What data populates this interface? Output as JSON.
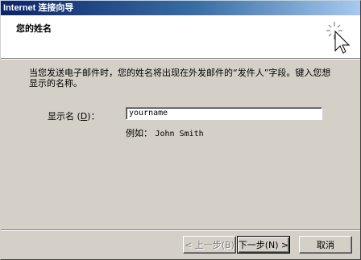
{
  "window": {
    "title": "Internet 连接向导"
  },
  "header": {
    "title": "您的姓名"
  },
  "description": "当您发送电子邮件时，您的姓名将出现在外发邮件的“发件人”字段。键入您想显示的名称。",
  "form": {
    "label_prefix": "显示名 (",
    "label_hotkey": "D",
    "label_suffix": ")：",
    "value": "yourname",
    "example_prefix": "例如：",
    "example_value": "John Smith"
  },
  "buttons": {
    "back": "< 上一步(B)",
    "next": "下一步(N) >",
    "cancel": "取消"
  }
}
